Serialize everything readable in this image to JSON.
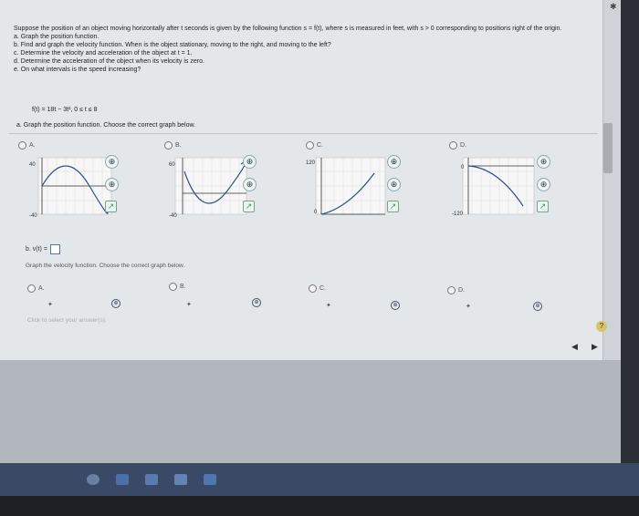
{
  "problem": {
    "intro": "Suppose the position of an object moving horizontally after t seconds is given by the following function s = f(t), where s is measured in feet, with s > 0 corresponding to positions right of the origin.",
    "parts": [
      "a. Graph the position function.",
      "b. Find and graph the velocity function. When is the object stationary, moving to the right, and moving to the left?",
      "c. Determine the velocity and acceleration of the object at t = 1.",
      "d. Determine the acceleration of the object when its velocity is zero.",
      "e. On what intervals is the speed increasing?"
    ],
    "function": "f(t) = 18t − 3t², 0 ≤ t ≤ 8"
  },
  "part_a": {
    "prompt": "a. Graph the position function. Choose the correct graph below.",
    "options": [
      {
        "label": "A.",
        "y_top": "40",
        "y_bottom": "-40"
      },
      {
        "label": "B.",
        "y_top": "60",
        "y_bottom": "-40"
      },
      {
        "label": "C.",
        "y_top": "120",
        "y_bottom": "0"
      },
      {
        "label": "D.",
        "y_top": "0",
        "y_bottom": "-120"
      }
    ]
  },
  "part_b": {
    "prompt": "b. v(t) =",
    "graph_prompt": "Graph the velocity function. Choose the correct graph below.",
    "options": [
      "A.",
      "B.",
      "C.",
      "D."
    ]
  },
  "hint": "Click to select your answer(s).",
  "help_label": "?",
  "nav": {
    "prev": "◀",
    "next": "▶"
  },
  "icons": {
    "zoom": "⊕",
    "external": "↗"
  }
}
